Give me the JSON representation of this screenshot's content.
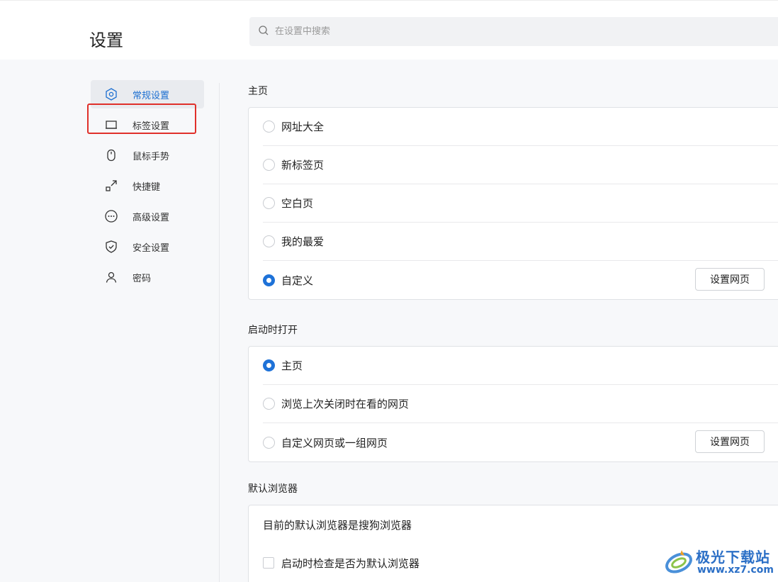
{
  "header": {
    "title": "设置",
    "search_placeholder": "在设置中搜索"
  },
  "sidebar": {
    "items": [
      {
        "label": "常规设置",
        "icon": "settings-hexagon-icon",
        "active": true
      },
      {
        "label": "标签设置",
        "icon": "tab-icon",
        "active": false
      },
      {
        "label": "鼠标手势",
        "icon": "mouse-icon",
        "active": false
      },
      {
        "label": "快捷键",
        "icon": "shortcut-icon",
        "active": false
      },
      {
        "label": "高级设置",
        "icon": "more-circle-icon",
        "active": false
      },
      {
        "label": "安全设置",
        "icon": "shield-icon",
        "active": false
      },
      {
        "label": "密码",
        "icon": "user-icon",
        "active": false
      }
    ]
  },
  "homepage": {
    "title": "主页",
    "options": [
      {
        "label": "网址大全",
        "checked": false
      },
      {
        "label": "新标签页",
        "checked": false
      },
      {
        "label": "空白页",
        "checked": false
      },
      {
        "label": "我的最爱",
        "checked": false
      },
      {
        "label": "自定义",
        "checked": true,
        "button": "设置网页"
      }
    ]
  },
  "startup": {
    "title": "启动时打开",
    "options": [
      {
        "label": "主页",
        "checked": true
      },
      {
        "label": "浏览上次关闭时在看的网页",
        "checked": false
      },
      {
        "label": "自定义网页或一组网页",
        "checked": false,
        "button": "设置网页"
      }
    ]
  },
  "default_browser": {
    "title": "默认浏览器",
    "status": "目前的默认浏览器是搜狗浏览器",
    "check_label": "启动时检查是否为默认浏览器"
  },
  "watermark": {
    "line1": "极光下载站",
    "line2": "www.xz7.com"
  },
  "colors": {
    "accent": "#1e72d8",
    "highlight": "#e0302a"
  }
}
